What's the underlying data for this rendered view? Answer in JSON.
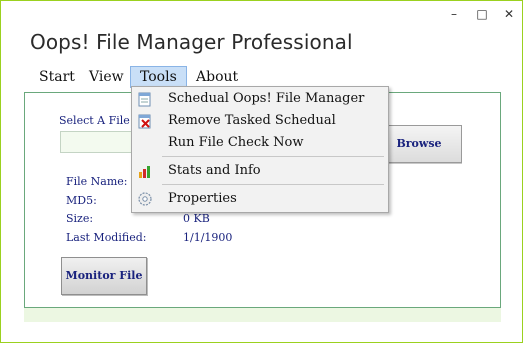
{
  "window": {
    "title": "Oops! File Manager Professional",
    "controls": {
      "minimize": "–",
      "maximize": "□",
      "close": "✕"
    }
  },
  "menu": {
    "start": "Start",
    "view": "View",
    "tools": "Tools",
    "about": "About"
  },
  "tools_menu": {
    "items": [
      {
        "label": "Schedual Oops! File Manager",
        "icon": "schedule-icon"
      },
      {
        "label": "Remove Tasked Schedual",
        "icon": "remove-schedule-icon"
      },
      {
        "label": "Run File Check Now",
        "icon": ""
      },
      {
        "label": "Stats and Info",
        "icon": "stats-chart-icon"
      },
      {
        "label": "Properties",
        "icon": "gear-icon"
      }
    ]
  },
  "form": {
    "select_file_label": "Select A File T",
    "file_path_value": "",
    "browse_label": "Browse",
    "monitor_label": "Monitor File"
  },
  "info": {
    "file_name_label": "File Name:",
    "file_name_value": "",
    "md5_label": "MD5:",
    "md5_value": "",
    "size_label": "Size:",
    "size_value": "0 KB",
    "modified_label": "Last Modified:",
    "modified_value": "1/1/1900"
  },
  "colors": {
    "window_border": "#9bd11f",
    "panel_border": "#6aa87c",
    "text_blue": "#1a237e",
    "menu_highlight": "#c9dff7"
  }
}
